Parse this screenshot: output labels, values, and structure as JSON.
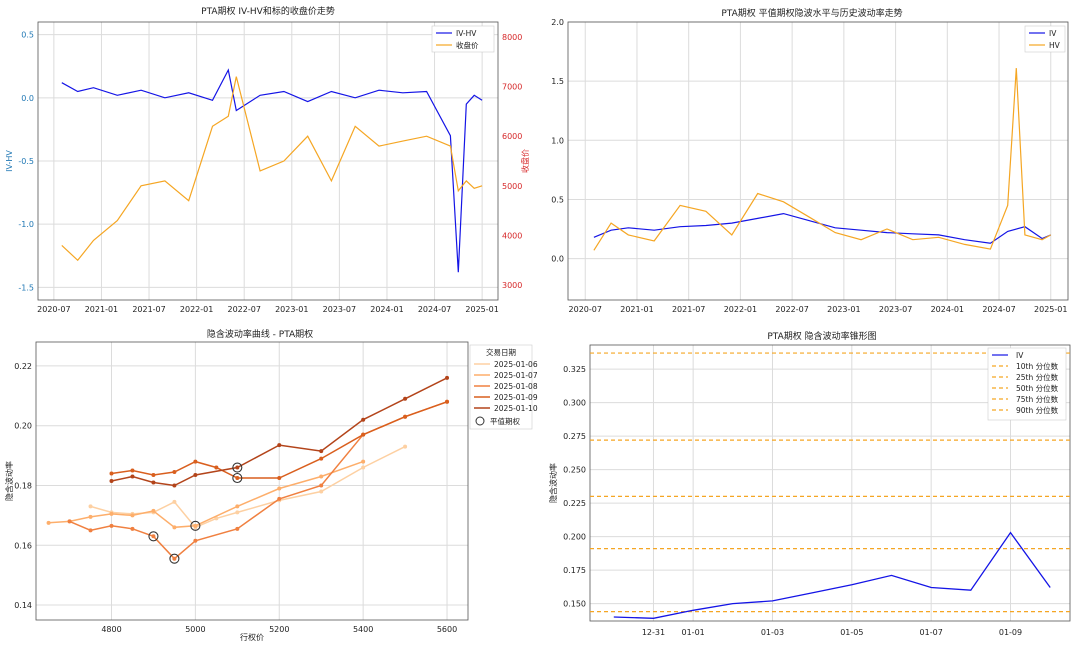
{
  "chart_data": [
    {
      "type": "line",
      "title": "PTA期权 IV-HV和标的收盘价走势",
      "ylabel": "IV-HV",
      "y2label": "收盘价",
      "x_ticks": [
        "2020-07",
        "2021-01",
        "2021-07",
        "2022-01",
        "2022-07",
        "2023-01",
        "2023-07",
        "2024-01",
        "2024-07",
        "2025-01"
      ],
      "y_ticks": [
        "0.5",
        "0.0",
        "-0.5",
        "-1.0",
        "-1.5"
      ],
      "y2_ticks": [
        "8000",
        "7000",
        "6000",
        "5000",
        "4000",
        "3000"
      ],
      "ylim": [
        -1.6,
        0.6
      ],
      "y2lim": [
        2700,
        8300
      ],
      "series": [
        {
          "name": "IV-HV",
          "color": "#1414e6",
          "axis": "left",
          "x": [
            "2020-08",
            "2020-10",
            "2020-12",
            "2021-03",
            "2021-06",
            "2021-09",
            "2021-12",
            "2022-03",
            "2022-05",
            "2022-06",
            "2022-09",
            "2022-12",
            "2023-03",
            "2023-06",
            "2023-09",
            "2023-12",
            "2024-03",
            "2024-06",
            "2024-09",
            "2024-10",
            "2024-11",
            "2024-12",
            "2025-01"
          ],
          "y": [
            0.12,
            0.05,
            0.08,
            0.02,
            0.06,
            0.0,
            0.04,
            -0.02,
            0.22,
            -0.1,
            0.02,
            0.05,
            -0.03,
            0.05,
            0.0,
            0.06,
            0.04,
            0.05,
            -0.3,
            -1.38,
            -0.05,
            0.02,
            -0.02
          ]
        },
        {
          "name": "收盘价",
          "color": "#f5a623",
          "axis": "right",
          "x": [
            "2020-08",
            "2020-10",
            "2020-12",
            "2021-03",
            "2021-06",
            "2021-09",
            "2021-12",
            "2022-03",
            "2022-05",
            "2022-06",
            "2022-09",
            "2022-12",
            "2023-03",
            "2023-06",
            "2023-09",
            "2023-12",
            "2024-03",
            "2024-06",
            "2024-09",
            "2024-10",
            "2024-11",
            "2024-12",
            "2025-01"
          ],
          "y": [
            3800,
            3500,
            3900,
            4300,
            5000,
            5100,
            4700,
            6200,
            6400,
            7200,
            5300,
            5500,
            6000,
            5100,
            6200,
            5800,
            5900,
            6000,
            5800,
            4900,
            5100,
            4950,
            5000
          ]
        }
      ]
    },
    {
      "type": "line",
      "title": "PTA期权 平值期权隐波水平与历史波动率走势",
      "x_ticks": [
        "2020-07",
        "2021-01",
        "2021-07",
        "2022-01",
        "2022-07",
        "2023-01",
        "2023-07",
        "2024-01",
        "2024-07",
        "2025-01"
      ],
      "y_ticks": [
        "2.0",
        "1.5",
        "1.0",
        "0.5",
        "0.0"
      ],
      "ylim": [
        -0.35,
        2.0
      ],
      "series": [
        {
          "name": "IV",
          "color": "#1414e6",
          "x": [
            "2020-08",
            "2020-10",
            "2020-12",
            "2021-03",
            "2021-06",
            "2021-09",
            "2021-12",
            "2022-03",
            "2022-06",
            "2022-09",
            "2022-12",
            "2023-03",
            "2023-06",
            "2023-09",
            "2023-12",
            "2024-03",
            "2024-06",
            "2024-08",
            "2024-10",
            "2024-12",
            "2025-01"
          ],
          "y": [
            0.18,
            0.24,
            0.26,
            0.24,
            0.27,
            0.28,
            0.3,
            0.34,
            0.38,
            0.32,
            0.26,
            0.24,
            0.22,
            0.21,
            0.2,
            0.16,
            0.13,
            0.23,
            0.27,
            0.17,
            0.2
          ]
        },
        {
          "name": "HV",
          "color": "#f5a623",
          "x": [
            "2020-08",
            "2020-10",
            "2020-12",
            "2021-03",
            "2021-06",
            "2021-09",
            "2021-12",
            "2022-03",
            "2022-06",
            "2022-09",
            "2022-12",
            "2023-03",
            "2023-06",
            "2023-09",
            "2023-12",
            "2024-03",
            "2024-06",
            "2024-08",
            "2024-09",
            "2024-10",
            "2024-12",
            "2025-01"
          ],
          "y": [
            0.07,
            0.3,
            0.2,
            0.15,
            0.45,
            0.4,
            0.2,
            0.55,
            0.48,
            0.35,
            0.22,
            0.16,
            0.25,
            0.16,
            0.18,
            0.12,
            0.08,
            0.45,
            1.61,
            0.2,
            0.16,
            0.2
          ]
        }
      ]
    },
    {
      "type": "line",
      "title": "隐含波动率曲线 - PTA期权",
      "xlabel": "行权价",
      "ylabel": "隐含波动率",
      "x_ticks": [
        4800,
        5000,
        5200,
        5400,
        5600
      ],
      "y_ticks": [
        "0.22",
        "0.20",
        "0.18",
        "0.16",
        "0.14"
      ],
      "xlim": [
        4620,
        5650
      ],
      "ylim": [
        0.135,
        0.228
      ],
      "legend_title": "交易日期",
      "atm_label": "平值期权",
      "series": [
        {
          "name": "2025-01-06",
          "color": "#fdd0a2",
          "x": [
            4750,
            4800,
            4850,
            4900,
            4950,
            5000,
            5050,
            5100,
            5200,
            5300,
            5400,
            5500
          ],
          "y": [
            0.173,
            0.171,
            0.1705,
            0.171,
            0.1745,
            0.166,
            0.169,
            0.171,
            0.175,
            0.178,
            0.186,
            0.193
          ]
        },
        {
          "name": "2025-01-07",
          "color": "#fdae6b",
          "x": [
            4650,
            4700,
            4750,
            4800,
            4850,
            4900,
            4950,
            5000,
            5100,
            5200,
            5300,
            5400
          ],
          "y": [
            0.1675,
            0.168,
            0.1695,
            0.1705,
            0.17,
            0.1715,
            0.166,
            0.1665,
            0.173,
            0.179,
            0.183,
            0.188
          ]
        },
        {
          "name": "2025-01-08",
          "color": "#f08040",
          "x": [
            4700,
            4750,
            4800,
            4850,
            4900,
            4950,
            5000,
            5100,
            5200,
            5300,
            5400,
            5500,
            5600
          ],
          "y": [
            0.168,
            0.165,
            0.1665,
            0.1655,
            0.163,
            0.1555,
            0.1615,
            0.1655,
            0.1755,
            0.18,
            0.197,
            0.203,
            0.208
          ]
        },
        {
          "name": "2025-01-09",
          "color": "#d95f1e",
          "x": [
            4800,
            4850,
            4900,
            4950,
            5000,
            5050,
            5100,
            5200,
            5300,
            5400,
            5500,
            5600
          ],
          "y": [
            0.184,
            0.185,
            0.1835,
            0.1845,
            0.188,
            0.186,
            0.1825,
            0.1825,
            0.189,
            0.197,
            0.203,
            0.208
          ]
        },
        {
          "name": "2025-01-10",
          "color": "#b3441a",
          "x": [
            4800,
            4850,
            4900,
            4950,
            5000,
            5100,
            5200,
            5300,
            5400,
            5500,
            5600
          ],
          "y": [
            0.1815,
            0.183,
            0.181,
            0.18,
            0.1835,
            0.186,
            0.1935,
            0.1915,
            0.202,
            0.209,
            0.216
          ]
        }
      ],
      "atm_points": [
        {
          "x": 4950,
          "y": 0.1555
        },
        {
          "x": 4900,
          "y": 0.163
        },
        {
          "x": 5000,
          "y": 0.1665
        },
        {
          "x": 5100,
          "y": 0.1825
        },
        {
          "x": 5100,
          "y": 0.186
        }
      ]
    },
    {
      "type": "line",
      "title": "PTA期权 隐含波动率锥形图",
      "ylabel": "隐含波动率",
      "x_ticks": [
        "12-31",
        "01-01",
        "01-03",
        "01-05",
        "01-07",
        "01-09"
      ],
      "y_ticks": [
        "0.325",
        "0.300",
        "0.275",
        "0.250",
        "0.225",
        "0.200",
        "0.175",
        "0.150"
      ],
      "ylim": [
        0.137,
        0.343
      ],
      "series": [
        {
          "name": "IV",
          "color": "#1414e6",
          "x": [
            "12-30",
            "12-31",
            "01-01",
            "01-02",
            "01-03",
            "01-04",
            "01-05",
            "01-06",
            "01-07",
            "01-08",
            "01-09",
            "01-10"
          ],
          "y": [
            0.14,
            0.139,
            0.145,
            0.15,
            0.152,
            0.158,
            0.164,
            0.171,
            0.162,
            0.16,
            0.203,
            0.162
          ]
        }
      ],
      "percentiles": [
        {
          "name": "10th 分位数",
          "value": 0.144
        },
        {
          "name": "25th 分位数",
          "value": 0.191
        },
        {
          "name": "50th 分位数",
          "value": 0.23
        },
        {
          "name": "75th 分位数",
          "value": 0.272
        },
        {
          "name": "90th 分位数",
          "value": 0.337
        }
      ]
    }
  ]
}
